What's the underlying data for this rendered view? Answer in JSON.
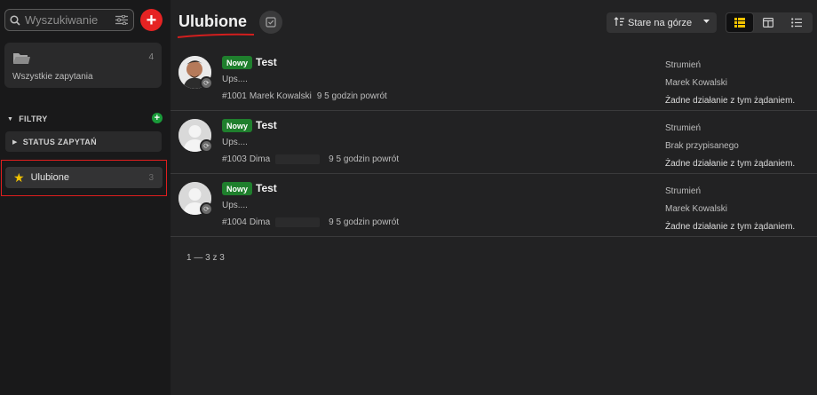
{
  "sidebar": {
    "search_placeholder": "Wyszukiwanie",
    "add_label": "+",
    "all_requests": {
      "label": "Wszystkie zapytania",
      "count": "4"
    },
    "filters_label": "FILTRY",
    "status_label": "STATUS ZAPYTAŃ",
    "favorites": {
      "label": "Ulubione",
      "count": "3"
    }
  },
  "main": {
    "title": "Ulubione",
    "sort_label": "Stare na górze",
    "rows": [
      {
        "status": "Nowy",
        "title": "Test",
        "desc": "Ups....",
        "id": "#1001",
        "name": "Marek Kowalski",
        "time": "9 5 godzin powrót",
        "stream": "Strumień",
        "assignee": "Marek Kowalski",
        "note": "Żadne działanie z tym żądaniem."
      },
      {
        "status": "Nowy",
        "title": "Test",
        "desc": "Ups....",
        "id": "#1003",
        "name": "Dima",
        "time": "9 5 godzin powrót",
        "stream": "Strumień",
        "assignee": "Brak przypisanego",
        "note": "Żadne działanie z tym żądaniem."
      },
      {
        "status": "Nowy",
        "title": "Test",
        "desc": "Ups....",
        "id": "#1004",
        "name": "Dima",
        "time": "9 5 godzin powrót",
        "stream": "Strumień",
        "assignee": "Marek Kowalski",
        "note": "Żadne działanie z tym żądaniem."
      }
    ],
    "pager": "1 — 3 z 3"
  },
  "colors": {
    "accent_red": "#e62323",
    "badge_green": "#1f7f2d",
    "star_yellow": "#f2c200"
  }
}
